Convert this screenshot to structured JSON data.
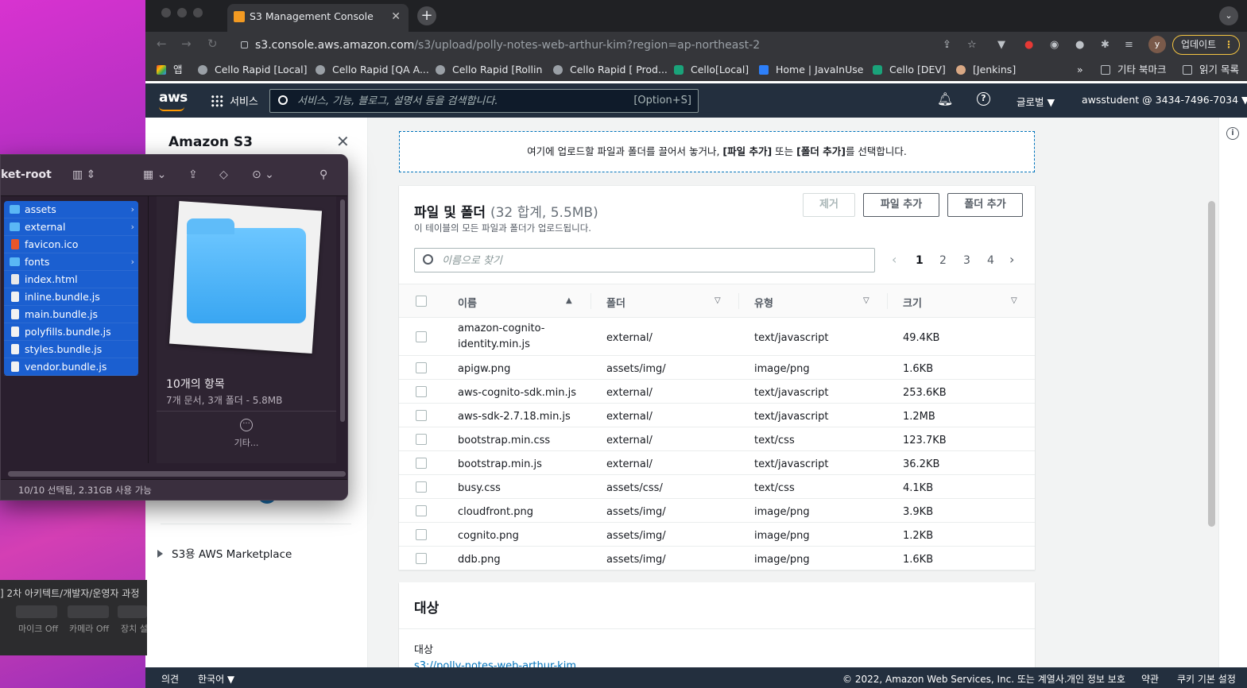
{
  "browser": {
    "tab_title": "S3 Management Console",
    "url_host": "s3.console.aws.amazon.com",
    "url_path": "/s3/upload/polly-notes-web-arthur-kim?region=ap-northeast-2",
    "profile_initial": "y",
    "update_label": "업데이트",
    "bookmarks": [
      "앱",
      "Cello Rapid [Local]",
      "Cello Rapid [QA A...",
      "Cello Rapid [Rollin",
      "Cello Rapid [ Prod...",
      "Cello[Local]",
      "Home | JavaInUse",
      "Cello [DEV]",
      "[Jenkins]"
    ],
    "bookmarks_more": "»",
    "other_bookmarks": "기타 북마크",
    "reading_list": "읽기 목록"
  },
  "aws_nav": {
    "logo": "aws",
    "services": "서비스",
    "search_placeholder": "서비스, 기능, 블로그, 설명서 등을 검색합니다.",
    "search_shortcut": "[Option+S]",
    "region": "글로벌 ▼",
    "account": "awsstudent @ 3434-7496-7034 ▼"
  },
  "s3_sidebar": {
    "title": "Amazon S3",
    "marketplace": "S3용 AWS Marketplace"
  },
  "dropzone": {
    "text_a": "여기에 업로드할 파일과 폴더를 끌어서 놓거나, ",
    "bold_a": "[파일 추가]",
    "text_b": " 또는 ",
    "bold_b": "[폴더 추가]",
    "text_c": "를 선택합니다."
  },
  "files_panel": {
    "title": "파일 및 폴더",
    "count": "(32 합계, 5.5MB)",
    "description": "이 테이블의 모든 파일과 폴더가 업로드됩니다.",
    "remove_button": "제거",
    "add_files_button": "파일 추가",
    "add_folder_button": "폴더 추가",
    "search_placeholder": "이름으로 찾기",
    "pages": [
      "1",
      "2",
      "3",
      "4"
    ],
    "current_page": "1",
    "columns": {
      "name": "이름",
      "folder": "폴더",
      "type": "유형",
      "size": "크기"
    },
    "rows": [
      {
        "name": "amazon-cognito-identity.min.js",
        "folder": "external/",
        "type": "text/javascript",
        "size": "49.4KB"
      },
      {
        "name": "apigw.png",
        "folder": "assets/img/",
        "type": "image/png",
        "size": "1.6KB"
      },
      {
        "name": "aws-cognito-sdk.min.js",
        "folder": "external/",
        "type": "text/javascript",
        "size": "253.6KB"
      },
      {
        "name": "aws-sdk-2.7.18.min.js",
        "folder": "external/",
        "type": "text/javascript",
        "size": "1.2MB"
      },
      {
        "name": "bootstrap.min.css",
        "folder": "external/",
        "type": "text/css",
        "size": "123.7KB"
      },
      {
        "name": "bootstrap.min.js",
        "folder": "external/",
        "type": "text/javascript",
        "size": "36.2KB"
      },
      {
        "name": "busy.css",
        "folder": "assets/css/",
        "type": "text/css",
        "size": "4.1KB"
      },
      {
        "name": "cloudfront.png",
        "folder": "assets/img/",
        "type": "image/png",
        "size": "3.9KB"
      },
      {
        "name": "cognito.png",
        "folder": "assets/img/",
        "type": "image/png",
        "size": "1.2KB"
      },
      {
        "name": "ddb.png",
        "folder": "assets/img/",
        "type": "image/png",
        "size": "1.6KB"
      }
    ]
  },
  "destination": {
    "heading": "대상",
    "label": "대상",
    "url": "s3://polly-notes-web-arthur-kim"
  },
  "footer": {
    "feedback": "의견",
    "language": "한국어 ▼",
    "copyright": "© 2022, Amazon Web Services, Inc. 또는 계열사.",
    "privacy": "개인 정보 보호",
    "terms": "약관",
    "cookies": "쿠키 기본 설정"
  },
  "finder": {
    "title": "ket-root",
    "items": [
      {
        "name": "assets",
        "kind": "folder"
      },
      {
        "name": "external",
        "kind": "folder"
      },
      {
        "name": "favicon.ico",
        "kind": "file"
      },
      {
        "name": "fonts",
        "kind": "folder"
      },
      {
        "name": "index.html",
        "kind": "file"
      },
      {
        "name": "inline.bundle.js",
        "kind": "file"
      },
      {
        "name": "main.bundle.js",
        "kind": "file"
      },
      {
        "name": "polyfills.bundle.js",
        "kind": "file"
      },
      {
        "name": "styles.bundle.js",
        "kind": "file"
      },
      {
        "name": "vendor.bundle.js",
        "kind": "file"
      }
    ],
    "preview_count": "10개의 항목",
    "preview_sub": "7개 문서, 3개 폴더 - 5.8MB",
    "more_label": "기타...",
    "status": "10/10 선택됨, 2.31GB 사용 가능"
  },
  "zoom_fragment": {
    "title": "] 2차 아키텍트/개발자/운영자 과정",
    "mic": "마이크 Off",
    "camera": "카메라 Off",
    "device": "장치 설"
  },
  "colors": {
    "aws_nav": "#232f3e",
    "aws_orange": "#ff9900",
    "link": "#0073bb",
    "finder_selection": "#1b5fd0"
  }
}
